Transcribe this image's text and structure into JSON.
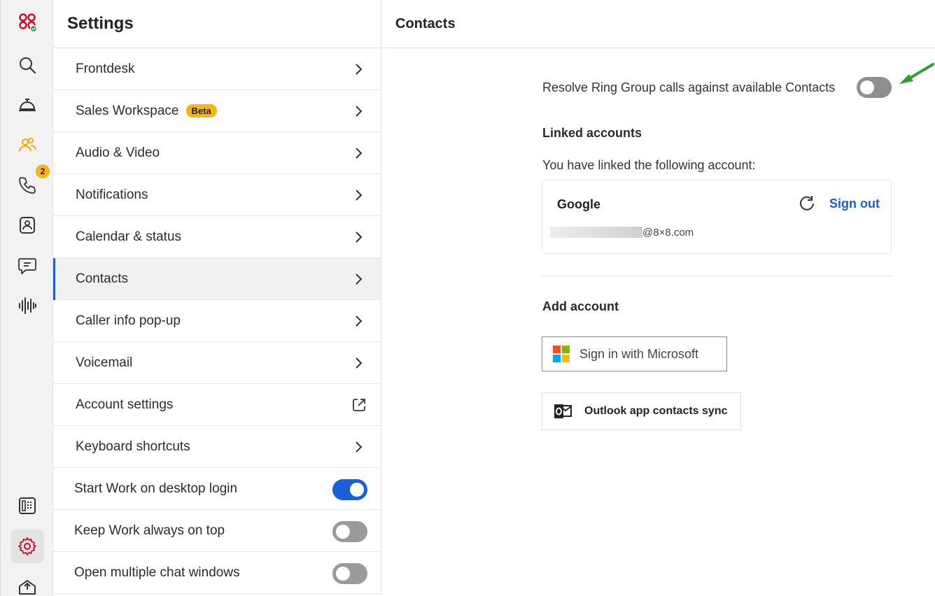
{
  "rail": {
    "phone_badge": "2"
  },
  "settings": {
    "title": "Settings",
    "items": [
      {
        "label": "Frontdesk"
      },
      {
        "label": "Sales Workspace",
        "badge": "Beta"
      },
      {
        "label": "Audio & Video"
      },
      {
        "label": "Notifications"
      },
      {
        "label": "Calendar & status"
      },
      {
        "label": "Contacts"
      },
      {
        "label": "Caller info pop-up"
      },
      {
        "label": "Voicemail"
      },
      {
        "label": "Account settings"
      },
      {
        "label": "Keyboard shortcuts"
      },
      {
        "label": "Start Work on desktop login",
        "toggle": true
      },
      {
        "label": "Keep Work always on top",
        "toggle": false
      },
      {
        "label": "Open multiple chat windows",
        "toggle": false
      }
    ],
    "selected": "Contacts"
  },
  "contacts": {
    "title": "Contacts",
    "resolve_label": "Resolve Ring Group calls against available Contacts",
    "resolve_toggle": false,
    "linked_heading": "Linked accounts",
    "linked_desc": "You have linked the following account:",
    "account": {
      "provider": "Google",
      "sign_out": "Sign out",
      "email_suffix": "@8×8.com"
    },
    "add_heading": "Add account",
    "ms_button": "Sign in with Microsoft",
    "outlook_button": "Outlook app contacts sync"
  },
  "colors": {
    "accent": "#1a5fd6",
    "badge": "#f5b31c",
    "brand": "#c8102e",
    "annotation_arrow": "#2ea02e"
  }
}
